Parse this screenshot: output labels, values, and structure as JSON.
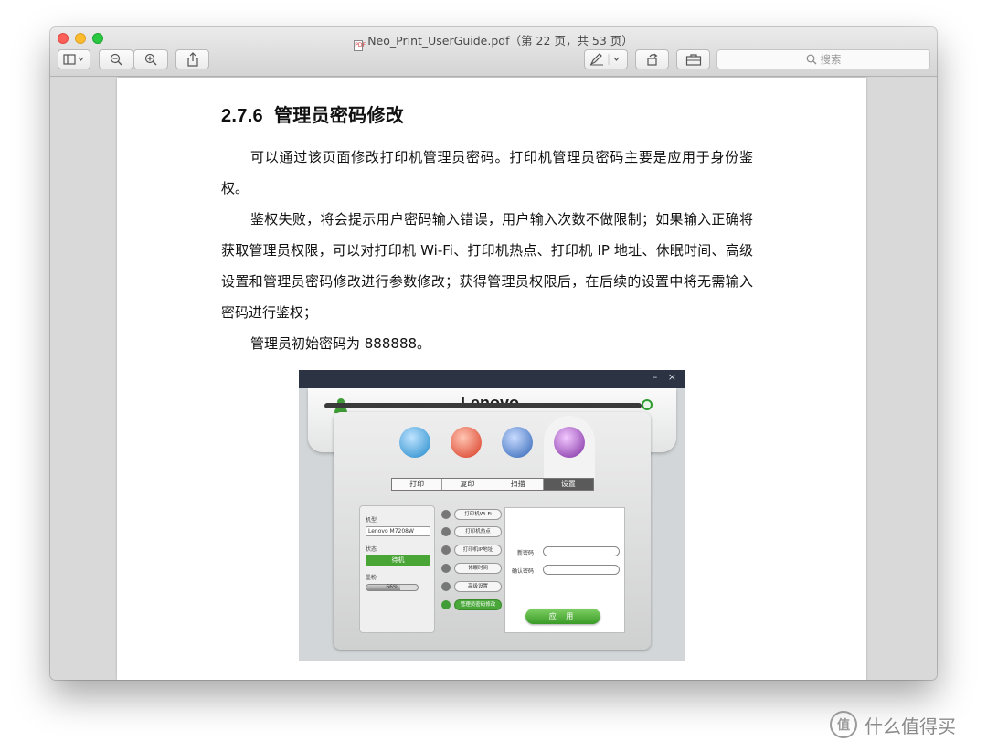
{
  "window": {
    "title": "Neo_Print_UserGuide.pdf（第 22 页，共 53 页）",
    "doc_icon_text": "PDF"
  },
  "toolbar": {
    "search_placeholder": "搜索"
  },
  "document": {
    "heading_num": "2.7.6",
    "heading_text": "管理员密码修改",
    "p1": "可以通过该页面修改打印机管理员密码。打印机管理员密码主要是应用于身份鉴权。",
    "p2": "鉴权失败，将会提示用户密码输入错误，用户输入次数不做限制；如果输入正确将获取管理员权限，可以对打印机 Wi-Fi、打印机热点、打印机 IP 地址、休眠时间、高级设置和管理员密码修改进行参数修改；获得管理员权限后，在后续的设置中将无需输入密码进行鉴权；",
    "p3": "管理员初始密码为 888888。"
  },
  "screenshot": {
    "brand": "Lenovo.",
    "win_controls": "– ×",
    "tabs": [
      "打印",
      "复印",
      "扫描",
      "设置"
    ],
    "model_label": "机型",
    "model_value": "Lenovo M7208W",
    "status_label": "状态",
    "status_value": "待机",
    "toner_label": "墨粉",
    "toner_text": "66%",
    "toner_fraction": 0.66,
    "menu": [
      "打印机Wi-Fi",
      "打印机热点",
      "打印机IP地址",
      "休眠时间",
      "高级设置",
      "管理员密码修改"
    ],
    "new_pw_label": "新密码",
    "confirm_pw_label": "确认密码",
    "apply_label": "应 用"
  },
  "watermark": {
    "logo": "值",
    "text": "什么值得买"
  }
}
